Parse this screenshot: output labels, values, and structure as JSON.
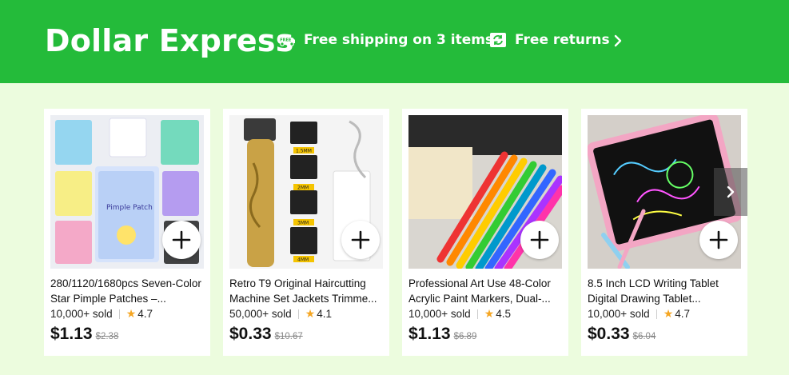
{
  "header": {
    "brand": "Dollar Express",
    "shipping_text": "Free shipping on 3 items",
    "returns_text": "Free returns"
  },
  "products": [
    {
      "title": "280/1120/1680pcs Seven-Color Star Pimple Patches –...",
      "sold": "10,000+ sold",
      "rating": "4.7",
      "price": "$1.13",
      "was": "$2.38",
      "package_label": "Pimple Patch"
    },
    {
      "title": "Retro T9 Original Haircutting Machine Set Jackets Trimme...",
      "sold": "50,000+ sold",
      "rating": "4.1",
      "price": "$0.33",
      "was": "$10.67",
      "guides": [
        "1.5MM",
        "2MM",
        "3MM",
        "4MM"
      ]
    },
    {
      "title": "Professional Art Use 48-Color Acrylic Paint Markers, Dual-...",
      "sold": "10,000+ sold",
      "rating": "4.5",
      "price": "$1.13",
      "was": "$6.89"
    },
    {
      "title": "8.5 Inch LCD Writing Tablet Digital Drawing Tablet...",
      "sold": "10,000+ sold",
      "rating": "4.7",
      "price": "$0.33",
      "was": "$6.04"
    }
  ],
  "colors": {
    "header_bg": "#24bb3a",
    "page_bg": "#ecfcde",
    "star": "#f5a623"
  },
  "icons": {
    "shipping": "truck-icon",
    "returns": "returns-icon",
    "add": "plus-icon",
    "next": "chevron-right-icon"
  }
}
